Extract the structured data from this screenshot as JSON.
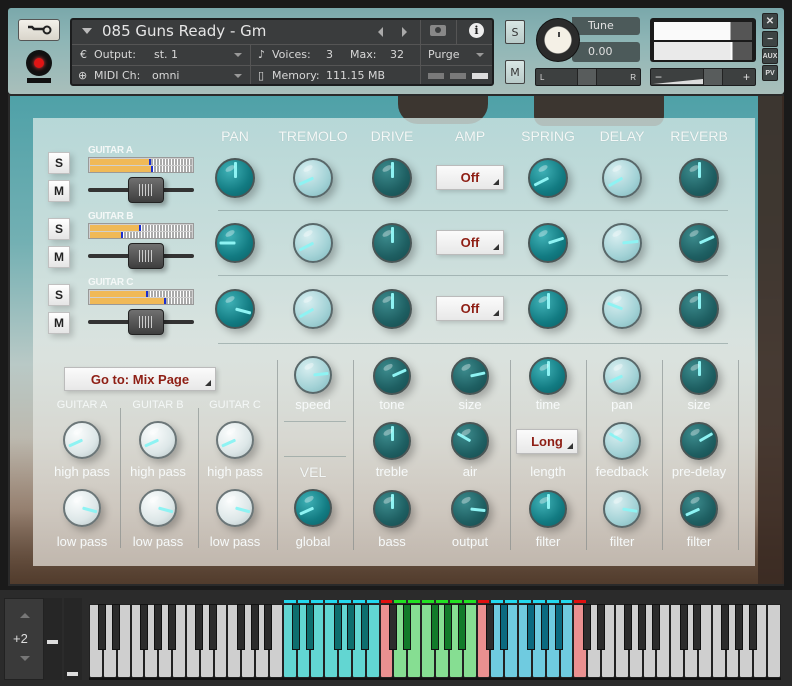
{
  "header": {
    "instrument_name": "085 Guns Ready - Gm",
    "output_label": "Output:",
    "output_value": "st. 1",
    "voices_label": "Voices:",
    "voices_value": "3",
    "max_label": "Max:",
    "max_value": "32",
    "midi_label": "MIDI Ch:",
    "midi_value": "omni",
    "memory_label": "Memory:",
    "memory_value": "111.15 MB",
    "purge_label": "Purge",
    "solo_label": "S",
    "mute_label": "M",
    "tune_label": "Tune",
    "tune_value": "0.00",
    "pan_left": "L",
    "pan_right": "R",
    "vol_minus": "−",
    "vol_plus": "+",
    "close_label": "✕",
    "minimize_label": "−",
    "aux_label": "AUX",
    "pv_label": "PV"
  },
  "columns": [
    "PAN",
    "TREMOLO",
    "DRIVE",
    "AMP",
    "SPRING",
    "DELAY",
    "REVERB"
  ],
  "channels": [
    {
      "name": "GUITAR A",
      "solo": "S",
      "mute": "M",
      "meter": [
        0.58,
        0.6
      ],
      "fader": 0.55,
      "knobs": {
        "pan": 0.5,
        "tremolo": 0.12,
        "drive": 0.5,
        "amp": "Off",
        "spring": 0.11,
        "delay": 0.1,
        "reverb": 0.5
      }
    },
    {
      "name": "GUITAR B",
      "solo": "S",
      "mute": "M",
      "meter": [
        0.48,
        0.3
      ],
      "fader": 0.55,
      "knobs": {
        "pan": 0.2,
        "tremolo": 0.11,
        "drive": 0.5,
        "amp": "Off",
        "spring": 0.74,
        "delay": 0.78,
        "reverb": 0.72
      }
    },
    {
      "name": "GUITAR C",
      "solo": "S",
      "mute": "M",
      "meter": [
        0.55,
        0.73
      ],
      "fader": 0.55,
      "knobs": {
        "pan": 0.85,
        "tremolo": 0.1,
        "drive": 0.5,
        "amp": "Off",
        "spring": 0.5,
        "delay": 0.27,
        "reverb": 0.5
      }
    }
  ],
  "goto": {
    "label": "Go to: Mix Page"
  },
  "filters": {
    "guitars": [
      "GUITAR A",
      "GUITAR B",
      "GUITAR C"
    ],
    "high_pass_label": "high pass",
    "low_pass_label": "low pass",
    "high_pass_values": [
      0.12,
      0.12,
      0.12
    ],
    "low_pass_values": [
      0.85,
      0.85,
      0.85
    ]
  },
  "tremolo": {
    "speed_label": "speed",
    "speed": 0.78
  },
  "vel": {
    "heading": "VEL",
    "global_label": "global",
    "global": 0.12
  },
  "drive_amp": {
    "tone_label": "tone",
    "tone": 0.72,
    "treble_label": "treble",
    "treble": 0.5,
    "bass_label": "bass",
    "bass": 0.5,
    "size_label": "size",
    "size": 0.76,
    "air_label": "air",
    "air": 0.3,
    "output_label": "output",
    "output": 0.82
  },
  "spring": {
    "time_label": "time",
    "time": 0.5,
    "length_label": "length",
    "length": "Long",
    "filter_label": "filter",
    "filter": 0.5
  },
  "delay": {
    "pan_label": "pan",
    "pan": 0.12,
    "feedback_label": "feedback",
    "feedback": 0.3,
    "filter_label": "filter",
    "filter": 0.83
  },
  "reverb": {
    "size_label": "size",
    "size": 0.5,
    "predelay_label": "pre-delay",
    "predelay": 0.7,
    "filter_label": "filter",
    "filter": 0.12
  },
  "keyboard": {
    "octave_offset": "+2",
    "zones": [
      {
        "name": "guitar-a-zone",
        "color": "#62d6d2",
        "dark": "#0e6e6e"
      },
      {
        "name": "guitar-b-zone",
        "color": "#86de92",
        "dark": "#127a2a"
      },
      {
        "name": "guitar-c-zone",
        "color": "#6fcbe0",
        "dark": "#0b6a80"
      },
      {
        "name": "keyswitch",
        "color": "#ea9090"
      }
    ]
  }
}
